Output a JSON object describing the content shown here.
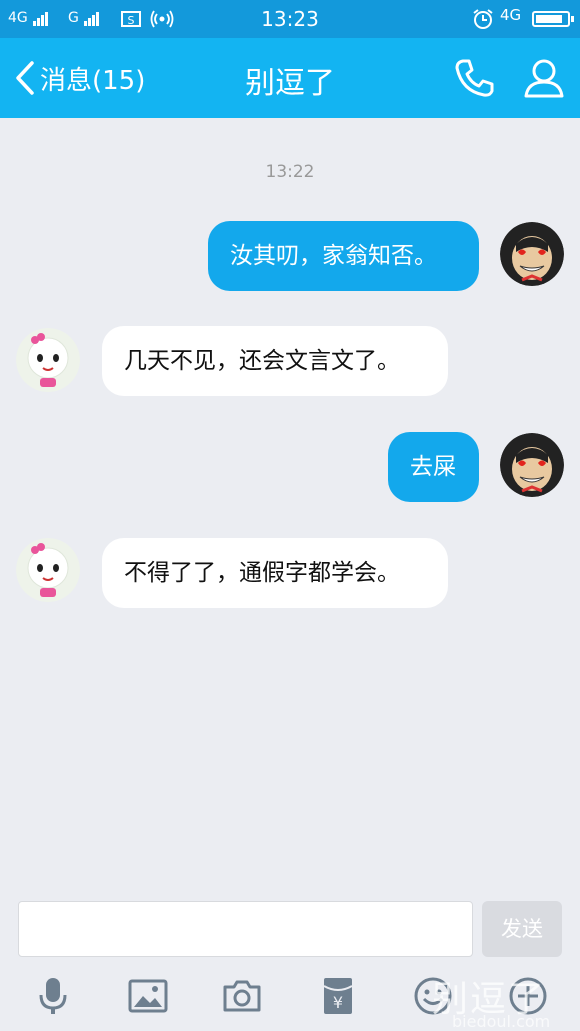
{
  "status_bar": {
    "network1": "4G",
    "network2": "G",
    "time": "13:23",
    "network3": "4G",
    "battery_level": 0.85
  },
  "header": {
    "back_label": "消息(15)",
    "title": "别逗了"
  },
  "chat": {
    "timestamp": "13:22",
    "messages": [
      {
        "side": "out",
        "text": "汝其叨，家翁知否。"
      },
      {
        "side": "in",
        "text": "几天不见，还会文言文了。"
      },
      {
        "side": "out",
        "text": "去屎"
      },
      {
        "side": "in",
        "text": "不得了了，通假字都学会。"
      }
    ]
  },
  "input_bar": {
    "send_label": "发送",
    "tools": [
      "microphone-icon",
      "image-icon",
      "camera-icon",
      "red-packet-icon",
      "emoji-icon",
      "plus-icon"
    ]
  },
  "watermark": {
    "text": "别逗了",
    "url": "biedoul.com"
  },
  "colors": {
    "title_bar": "#13b4f2",
    "status_bar": "#1399db",
    "outgoing_bubble": "#13a8ec",
    "incoming_bubble": "#ffffff",
    "background": "#ebedf2"
  }
}
